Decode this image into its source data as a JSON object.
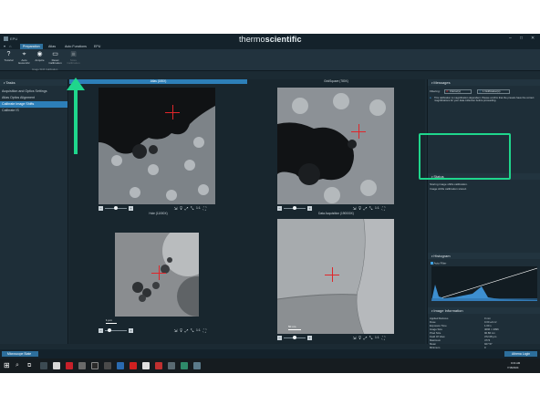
{
  "app": {
    "title": "EPU",
    "brand_thermo": "thermo",
    "brand_scientific": "scientific",
    "window_controls": [
      "–",
      "□",
      "✕"
    ]
  },
  "menu": {
    "items": [
      "Preparation",
      "Atlas",
      "Auto Functions",
      "EPU"
    ],
    "active_index": 0
  },
  "ribbon": {
    "buttons": [
      {
        "label": "Tutorial",
        "icon": "question-icon",
        "glyph": "?"
      },
      {
        "label": "Auto Eucentric",
        "icon": "eucentric-icon",
        "glyph": "⌖"
      },
      {
        "label": "Acquire",
        "icon": "camera-icon",
        "glyph": "◉"
      },
      {
        "label": "Reset Calibration",
        "icon": "reset-icon",
        "glyph": "▭"
      },
      {
        "label": "Store Calibration",
        "icon": "save-icon",
        "glyph": "▣"
      }
    ],
    "group_label": "Image Shift Calibration"
  },
  "tasks": {
    "header": "Tasks",
    "items": [
      "Acquisition and Optics Settings",
      "Atlas Optics Alignment",
      "Calibrate Image Shifts",
      "Calibrate IS"
    ],
    "selected_index": 2
  },
  "panes": [
    {
      "title": "Atlas (155X)",
      "active": true,
      "zoom": "1:1"
    },
    {
      "title": "GridSquare (780X)",
      "active": false,
      "zoom": "1:1"
    },
    {
      "title": "Hole (11000X)",
      "active": false,
      "zoom": "1:1",
      "scale_label": "1 µm"
    },
    {
      "title": "Data Acquisition (190000X)",
      "active": false,
      "zoom": "1:1",
      "scale_label": "50 nm"
    }
  ],
  "messages": {
    "header": "Messages",
    "filtering_label": "Filtering:",
    "errors_label": "0 Error(s)",
    "notifications_label": "1 Notification(s)",
    "notification_text": "This calibration is magnification dependent. Please confirm that the presets have the correct magnifications for your data collection before proceeding."
  },
  "status": {
    "header": "Status",
    "lines": [
      "Storing image shifts calibration.",
      "Image shifts calibration stored."
    ]
  },
  "histogram": {
    "header": "Histogram",
    "autofilter_label": "Auto Filter"
  },
  "image_information": {
    "header": "Image Information",
    "rows": [
      {
        "label": "Applied Defocus",
        "value": "0 mm"
      },
      {
        "label": "Dose",
        "value": "0.00 e/nm²"
      },
      {
        "label": "Exposure Time",
        "value": "1.00 s"
      },
      {
        "label": "Image Size",
        "value": "4096 × 4096"
      },
      {
        "label": "Pixel Size",
        "value": "90.86 nm"
      },
      {
        "label": "Field Of View",
        "value": "372.08 µm"
      },
      {
        "label": "Maximum",
        "value": "4774"
      },
      {
        "label": "Mean",
        "value": "927.57"
      },
      {
        "label": "Minimum",
        "value": "0"
      }
    ]
  },
  "statusbar": {
    "microscope_state": "Microscope State",
    "athena_login": "Athena Login"
  },
  "taskbar": {
    "time": "9:04 AM",
    "date": "7/18/2024"
  },
  "colors": {
    "accent_green": "#1fd68c",
    "selection_blue": "#2d7fb8",
    "crosshair_red": "#e0262a"
  }
}
